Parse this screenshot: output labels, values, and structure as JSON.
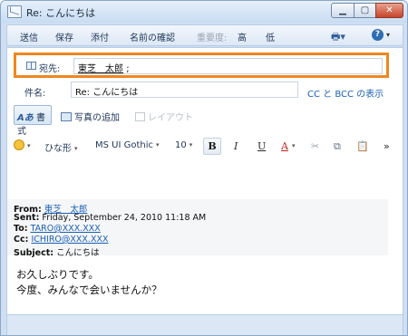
{
  "window": {
    "title": "Re: こんにちは"
  },
  "toolbar": {
    "send": "送信",
    "save": "保存",
    "attach": "添付",
    "check_names": "名前の確認",
    "importance_label": "重要度:",
    "high": "高",
    "low": "低",
    "help_icon": "help-icon"
  },
  "compose": {
    "to_label": "宛先:",
    "to_name": "東芝　太郎",
    "to_separator": ";",
    "subject_label": "件名:",
    "subject_value": "Re: こんにちは",
    "ccbcc_link": "CC と BCC の表示"
  },
  "ribbon": {
    "format_label": "書式",
    "format_icon_text": "Aあ",
    "add_photo": "写真の追加",
    "layout": "レイアウト"
  },
  "format": {
    "font_kana": "ひな形",
    "font_name": "MS UI Gothic",
    "font_size": "10",
    "bold": "B",
    "italic": "I",
    "underline": "U",
    "font_color": "A",
    "more": "»"
  },
  "quoted": {
    "from_label": "From:",
    "from_value": "東芝　太郎",
    "sent_label": "Sent:",
    "sent_value": "Friday, September 24, 2010 11:18 AM",
    "to_label": "To:",
    "to_value": "TARO@XXX.XXX",
    "cc_label": "Cc:",
    "cc_value": "ICHIRO@XXX.XXX",
    "subject_label": "Subject:",
    "subject_value": "こんにちは"
  },
  "body": {
    "line1": "お久しぶりです。",
    "line2": "今度、みんなで会いませんか？"
  },
  "colors": {
    "highlight_border": "#f0861e",
    "link": "#1a5fb4",
    "window_frame": "#cfdff1"
  }
}
